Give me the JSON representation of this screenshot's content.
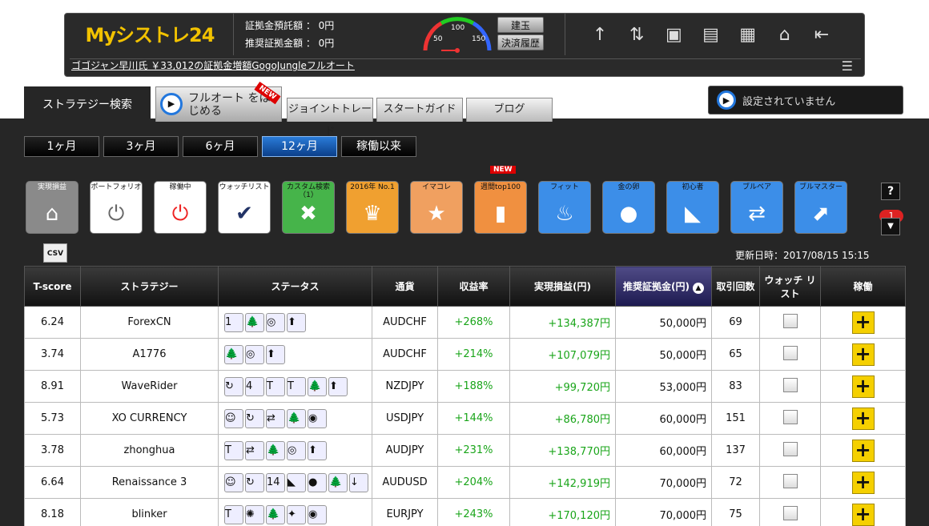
{
  "header": {
    "logo": "Myシストレ24",
    "deposit_label": "証拠金預託額 ：",
    "deposit_value": "0円",
    "margin_label": "推奨証拠金額 ：",
    "margin_value": "0円",
    "gauge_ticks": [
      "50",
      "100",
      "150"
    ],
    "positions_button": "建玉",
    "history_button": "決済履歴",
    "ticker": "ゴゴジャン早川氏 ￥33,012の証拠金増額GogoJungleフルオート"
  },
  "tabs": {
    "strategy_search": "ストラテジー検索",
    "full_auto": "フルオート をはじめる",
    "new_badge": "NEW",
    "joint_trade": "ジョイントトレード",
    "start_guide": "スタートガイド",
    "blog": "ブログ"
  },
  "setup_status": "設定されていません",
  "periods": [
    "1ヶ月",
    "3ヶ月",
    "6ヶ月",
    "12ヶ月",
    "稼働以来"
  ],
  "active_period": "12ヶ月",
  "categories": [
    {
      "label": "実現損益",
      "icon": "house-icon",
      "bg": "#8a8a8a"
    },
    {
      "label": "ポートフォリオ",
      "icon": "power-icon",
      "bg": "#ffffff"
    },
    {
      "label": "稼働中",
      "icon": "power-red-icon",
      "bg": "#ffffff"
    },
    {
      "label": "ウォッチリスト",
      "icon": "check-icon",
      "bg": "#ffffff"
    },
    {
      "label": "カスタム検索（1）",
      "icon": "tools-icon",
      "bg": "#46b44a"
    },
    {
      "label": "2016年 No.1",
      "icon": "trophy-icon",
      "bg": "#f0a030"
    },
    {
      "label": "イマコレ",
      "icon": "star-icon",
      "bg": "#f0a060"
    },
    {
      "label": "週間top100",
      "icon": "top100-icon",
      "bg": "#f09040"
    },
    {
      "label": "フィット",
      "icon": "fire-icon",
      "bg": "#3c8ee8"
    },
    {
      "label": "金の卵",
      "icon": "egg-icon",
      "bg": "#3c8ee8"
    },
    {
      "label": "初心者",
      "icon": "beginner-icon",
      "bg": "#3c8ee8"
    },
    {
      "label": "ブルベア",
      "icon": "bullbear-icon",
      "bg": "#3c8ee8"
    },
    {
      "label": "ブルマスター",
      "icon": "bullmaster-icon",
      "bg": "#3c8ee8"
    }
  ],
  "new_label": "NEW",
  "help": "?",
  "notification_count": "1",
  "csv": "CSV",
  "updated": "更新日時：2017/08/15 15:15",
  "table": {
    "headers": [
      "T-score",
      "ストラテジー",
      "ステータス",
      "通貨",
      "収益率",
      "実現損益(円)",
      "推奨証拠金(円)",
      "取引回数",
      "ウォッチ リスト",
      "稼働"
    ],
    "rows": [
      {
        "tscore": "6.24",
        "name": "ForexCN",
        "status": [
          "1",
          "🌲",
          "◎",
          "⬆"
        ],
        "pair": "AUDCHF",
        "rate": "+268%",
        "pnl": "+134,387円",
        "margin": "50,000円",
        "trades": "69"
      },
      {
        "tscore": "3.74",
        "name": "A1776",
        "status": [
          "🌲",
          "◎",
          "⬆"
        ],
        "pair": "AUDCHF",
        "rate": "+214%",
        "pnl": "+107,079円",
        "margin": "50,000円",
        "trades": "65"
      },
      {
        "tscore": "8.91",
        "name": "WaveRider",
        "status": [
          "↻",
          "4",
          "T",
          "T",
          "🌲",
          "⬆"
        ],
        "pair": "NZDJPY",
        "rate": "+188%",
        "pnl": "+99,720円",
        "margin": "53,000円",
        "trades": "83"
      },
      {
        "tscore": "5.73",
        "name": "XO CURRENCY",
        "status": [
          "☺",
          "↻",
          "⇄",
          "🌲",
          "◉"
        ],
        "pair": "USDJPY",
        "rate": "+144%",
        "pnl": "+86,780円",
        "margin": "60,000円",
        "trades": "151"
      },
      {
        "tscore": "3.78",
        "name": "zhonghua",
        "status": [
          "T",
          "⇄",
          "🌲",
          "◎",
          "⬆"
        ],
        "pair": "AUDJPY",
        "rate": "+231%",
        "pnl": "+138,770円",
        "margin": "60,000円",
        "trades": "137"
      },
      {
        "tscore": "6.64",
        "name": "Renaissance 3",
        "status": [
          "☺",
          "↻",
          "14",
          "◣",
          "●",
          "🌲",
          "↓"
        ],
        "pair": "AUDUSD",
        "rate": "+204%",
        "pnl": "+142,919円",
        "margin": "70,000円",
        "trades": "72"
      },
      {
        "tscore": "8.18",
        "name": "blinker",
        "status": [
          "T",
          "✺",
          "🌲",
          "✦",
          "◉"
        ],
        "pair": "EURJPY",
        "rate": "+243%",
        "pnl": "+170,120円",
        "margin": "70,000円",
        "trades": "75"
      }
    ]
  }
}
